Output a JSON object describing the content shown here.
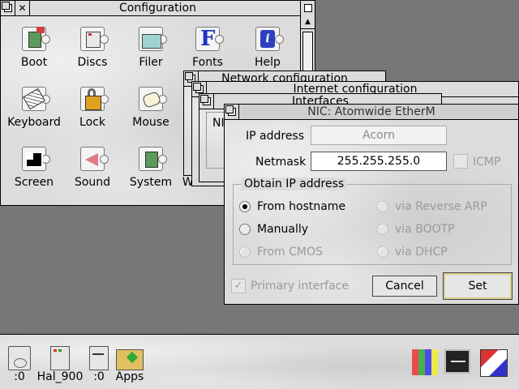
{
  "config_window": {
    "title": "Configuration",
    "icons": [
      {
        "label": "Boot"
      },
      {
        "label": "Discs"
      },
      {
        "label": "Filer"
      },
      {
        "label": "Fonts"
      },
      {
        "label": "Help"
      },
      {
        "label": "Keyboard"
      },
      {
        "label": "Lock"
      },
      {
        "label": "Mouse"
      },
      {
        "label": "Screen"
      },
      {
        "label": "Sound"
      },
      {
        "label": "System"
      },
      {
        "label": "Windows"
      }
    ]
  },
  "windows": {
    "network_config_title": "Network configuration",
    "internet_config_title": "Internet configuration",
    "interfaces_title": "Interfaces",
    "interfaces_partial_label": "NI"
  },
  "dialog": {
    "title": "NIC: Atomwide EtherM",
    "ip_label": "IP address",
    "ip_value": "Acorn",
    "netmask_label": "Netmask",
    "netmask_value": "255.255.255.0",
    "icmp_label": "ICMP",
    "group_label": "Obtain IP address",
    "options": {
      "from_hostname": "From hostname",
      "manually": "Manually",
      "from_cmos": "From CMOS",
      "reverse_arp": "via Reverse ARP",
      "bootp": "via BOOTP",
      "dhcp": "via DHCP"
    },
    "selected_option": "from_hostname",
    "primary_label": "Primary interface",
    "primary_checked": true,
    "cancel_label": "Cancel",
    "set_label": "Set"
  },
  "iconbar": {
    "left": [
      {
        "label": ":0",
        "icon": "floppy-drive-icon"
      },
      {
        "label": "Hal_900",
        "icon": "network-drive-icon"
      },
      {
        "label": ":0",
        "icon": "ram-disc-icon"
      },
      {
        "label": "Apps",
        "icon": "apps-folder-icon"
      }
    ],
    "right": [
      {
        "icon": "display-manager-icon"
      },
      {
        "icon": "task-manager-icon"
      },
      {
        "icon": "acorn-cube-icon"
      }
    ]
  }
}
